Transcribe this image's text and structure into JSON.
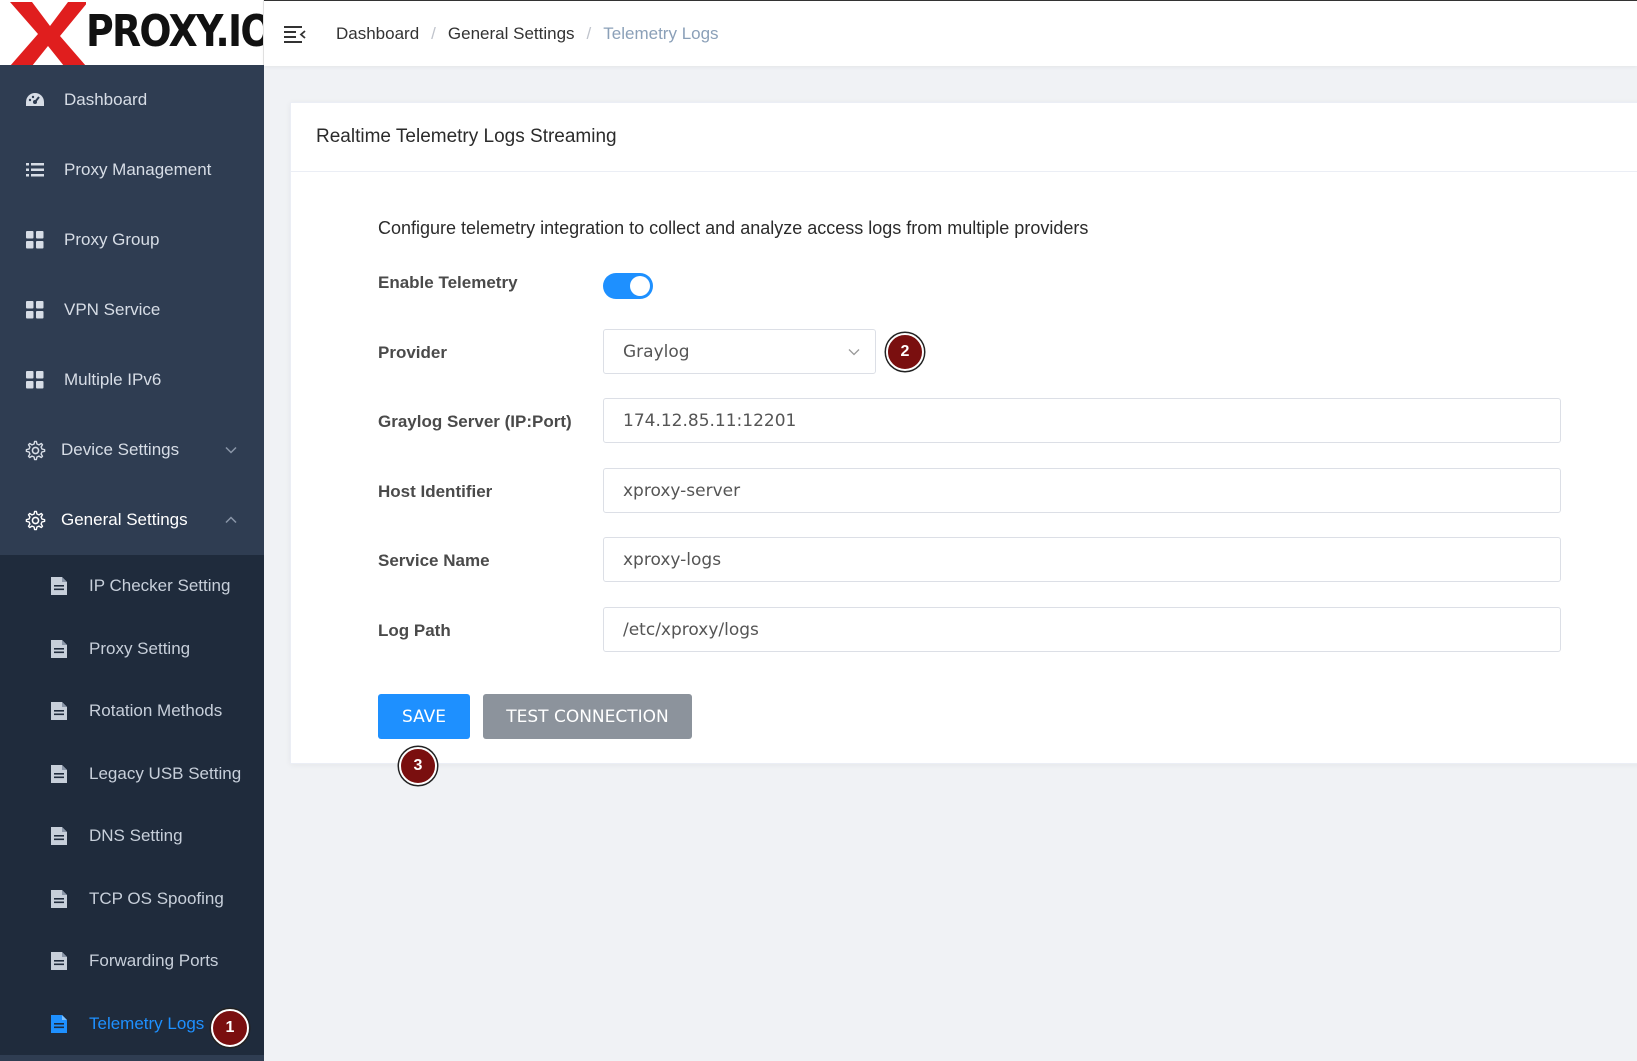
{
  "app": {
    "logo_text": "PROXY.IO",
    "accent_color": "#1e90ff",
    "sidebar_bg": "#2f3d52",
    "submenu_bg": "#1f2b3c",
    "badge_color": "#7a0f0f"
  },
  "sidebar": {
    "items": [
      {
        "label": "Dashboard",
        "icon": "dashboard-gauge-icon"
      },
      {
        "label": "Proxy Management",
        "icon": "list-icon"
      },
      {
        "label": "Proxy Group",
        "icon": "grid-icon"
      },
      {
        "label": "VPN Service",
        "icon": "grid-icon"
      },
      {
        "label": "Multiple IPv6",
        "icon": "grid-icon"
      },
      {
        "label": "Device Settings",
        "icon": "gear-icon",
        "expanded": false
      },
      {
        "label": "General Settings",
        "icon": "gear-icon",
        "expanded": true
      }
    ],
    "submenu": [
      {
        "label": "IP Checker Setting",
        "icon": "document-icon"
      },
      {
        "label": "Proxy Setting",
        "icon": "document-icon"
      },
      {
        "label": "Rotation Methods",
        "icon": "document-icon"
      },
      {
        "label": "Legacy USB Setting",
        "icon": "document-icon"
      },
      {
        "label": "DNS Setting",
        "icon": "document-icon"
      },
      {
        "label": "TCP OS Spoofing",
        "icon": "document-icon"
      },
      {
        "label": "Forwarding Ports",
        "icon": "document-icon"
      },
      {
        "label": "Telemetry Logs",
        "icon": "document-icon",
        "active": true
      }
    ]
  },
  "breadcrumb": {
    "items": [
      "Dashboard",
      "General Settings",
      "Telemetry Logs"
    ],
    "separator": "/"
  },
  "card": {
    "title": "Realtime Telemetry Logs Streaming",
    "description": "Configure telemetry integration to collect and analyze access logs from multiple providers"
  },
  "form": {
    "enable_telemetry": {
      "label": "Enable Telemetry",
      "value": true
    },
    "provider": {
      "label": "Provider",
      "value": "Graylog"
    },
    "server": {
      "label": "Graylog Server (IP:Port)",
      "value": "174.12.85.11:12201"
    },
    "host_identifier": {
      "label": "Host Identifier",
      "value": "xproxy-server"
    },
    "service_name": {
      "label": "Service Name",
      "value": "xproxy-logs"
    },
    "log_path": {
      "label": "Log Path",
      "value": "/etc/xproxy/logs"
    }
  },
  "buttons": {
    "save": "SAVE",
    "test_connection": "TEST CONNECTION"
  },
  "badges": [
    "1",
    "2",
    "3"
  ]
}
